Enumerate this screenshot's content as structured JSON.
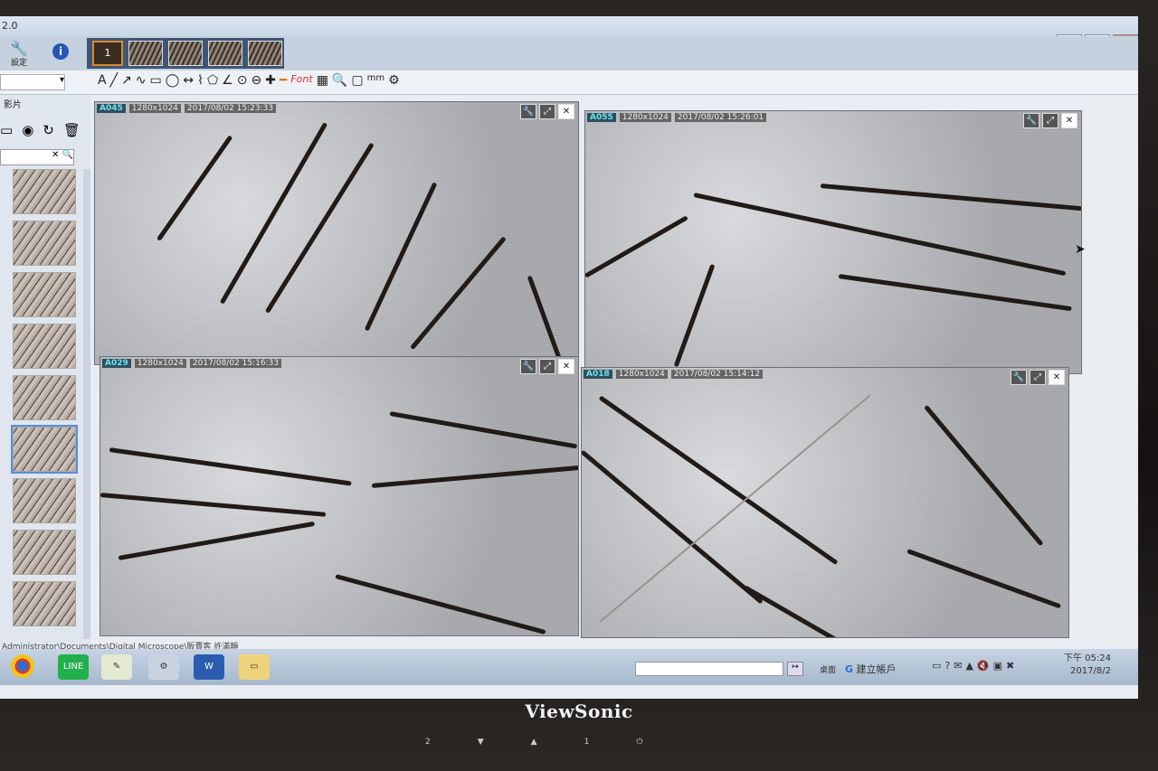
{
  "window": {
    "version": "2.0",
    "min": "—",
    "max": "❐",
    "close": "✕"
  },
  "top": {
    "settings_label": "設定",
    "info": "i",
    "frame_number": "1"
  },
  "toolbar": {
    "text_tool": "A",
    "font_label": "Font",
    "unit": "mm"
  },
  "left": {
    "tab": "影片"
  },
  "panels": [
    {
      "id": "A045",
      "res": "1280x1024",
      "time": "2017/08/02 15:23:33"
    },
    {
      "id": "A055",
      "res": "1280x1024",
      "time": "2017/08/02 15:26:01"
    },
    {
      "id": "A029",
      "res": "1280x1024",
      "time": "2017/08/02 15:16:33"
    },
    {
      "id": "A018",
      "res": "1280x1024",
      "time": "2017/08/02 15:14:12"
    }
  ],
  "status": {
    "path": "Administrator\\Documents\\Digital Microscope\\販賣客 許滿韻"
  },
  "taskbar": {
    "line": "LINE",
    "word": "W",
    "desktop": "桌面",
    "g_text": "建立帳戶",
    "clock_ampm": "下午 05:24",
    "clock_date": "2017/8/2"
  },
  "monitor": {
    "brand": "ViewSonic",
    "btn1": "2",
    "btn2": "▼",
    "btn3": "▲",
    "btn4": "1",
    "btn5": "⏻"
  }
}
